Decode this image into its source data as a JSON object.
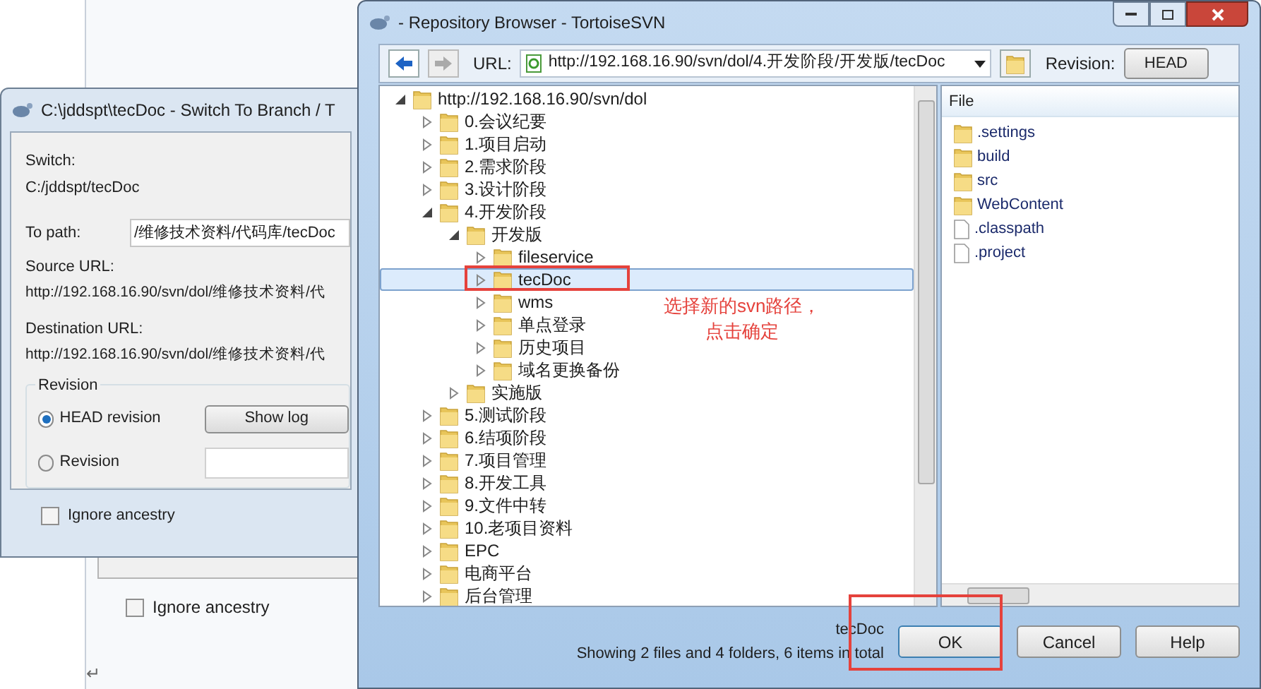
{
  "background_document": {
    "checkbox": {
      "label": "Ignore ancestry",
      "checked": false
    },
    "paragraph_mark": "↵"
  },
  "switch_dialog": {
    "title": "C:\\jddspt\\tecDoc - Switch To Branch / T",
    "switch_label": "Switch:",
    "switch_path": "C:/jddspt/tecDoc",
    "to_path_label": "To path:",
    "to_path_value": "/维修技术资料/代码库/tecDoc",
    "source_url_label": "Source URL:",
    "source_url": "http://192.168.16.90/svn/dol/维修技术资料/代",
    "destination_url_label": "Destination URL:",
    "destination_url": "http://192.168.16.90/svn/dol/维修技术资料/代",
    "revision_group": {
      "title": "Revision",
      "options": [
        {
          "label": "HEAD revision",
          "selected": true
        },
        {
          "label": "Revision",
          "selected": false
        }
      ],
      "show_log_button": "Show log"
    },
    "ignore_ancestry": {
      "label": "Ignore ancestry",
      "checked": false
    }
  },
  "repo_browser": {
    "title": "- Repository Browser - TortoiseSVN",
    "url_label": "URL:",
    "url": "http://192.168.16.90/svn/dol/4.开发阶段/开发版/tecDoc",
    "revision_label": "Revision:",
    "revision_button": "HEAD",
    "tree": [
      {
        "label": "http://192.168.16.90/svn/dol",
        "expanded": true,
        "selected": false,
        "children": [
          {
            "label": "0.会议纪要",
            "expanded": false,
            "selected": false
          },
          {
            "label": "1.项目启动",
            "expanded": false,
            "selected": false
          },
          {
            "label": "2.需求阶段",
            "expanded": false,
            "selected": false
          },
          {
            "label": "3.设计阶段",
            "expanded": false,
            "selected": false
          },
          {
            "label": "4.开发阶段",
            "expanded": true,
            "selected": false,
            "children": [
              {
                "label": "开发版",
                "expanded": true,
                "selected": false,
                "children": [
                  {
                    "label": "fileservice",
                    "expanded": false,
                    "selected": false
                  },
                  {
                    "label": "tecDoc",
                    "expanded": false,
                    "selected": true
                  },
                  {
                    "label": "wms",
                    "expanded": false,
                    "selected": false
                  },
                  {
                    "label": "单点登录",
                    "expanded": false,
                    "selected": false
                  },
                  {
                    "label": "历史项目",
                    "expanded": false,
                    "selected": false
                  },
                  {
                    "label": "域名更换备份",
                    "expanded": false,
                    "selected": false
                  }
                ]
              },
              {
                "label": "实施版",
                "expanded": false,
                "selected": false
              }
            ]
          },
          {
            "label": "5.测试阶段",
            "expanded": false,
            "selected": false
          },
          {
            "label": "6.结项阶段",
            "expanded": false,
            "selected": false
          },
          {
            "label": "7.项目管理",
            "expanded": false,
            "selected": false
          },
          {
            "label": "8.开发工具",
            "expanded": false,
            "selected": false
          },
          {
            "label": "9.文件中转",
            "expanded": false,
            "selected": false
          },
          {
            "label": "10.老项目资料",
            "expanded": false,
            "selected": false
          },
          {
            "label": "EPC",
            "expanded": false,
            "selected": false
          },
          {
            "label": "电商平台",
            "expanded": false,
            "selected": false
          },
          {
            "label": "后台管理",
            "expanded": false,
            "selected": false
          }
        ]
      }
    ],
    "file_list": {
      "column": "File",
      "items": [
        {
          "name": ".settings",
          "kind": "folder"
        },
        {
          "name": "build",
          "kind": "folder"
        },
        {
          "name": "src",
          "kind": "folder"
        },
        {
          "name": "WebContent",
          "kind": "folder"
        },
        {
          "name": ".classpath",
          "kind": "file"
        },
        {
          "name": ".project",
          "kind": "file"
        }
      ]
    },
    "status": {
      "selected_name": "tecDoc",
      "summary": "Showing 2 files and 4 folders, 6 items in total"
    },
    "buttons": [
      "OK",
      "Cancel",
      "Help"
    ]
  },
  "annotation": {
    "lines": [
      "选择新的svn路径，",
      "点击确定"
    ]
  }
}
